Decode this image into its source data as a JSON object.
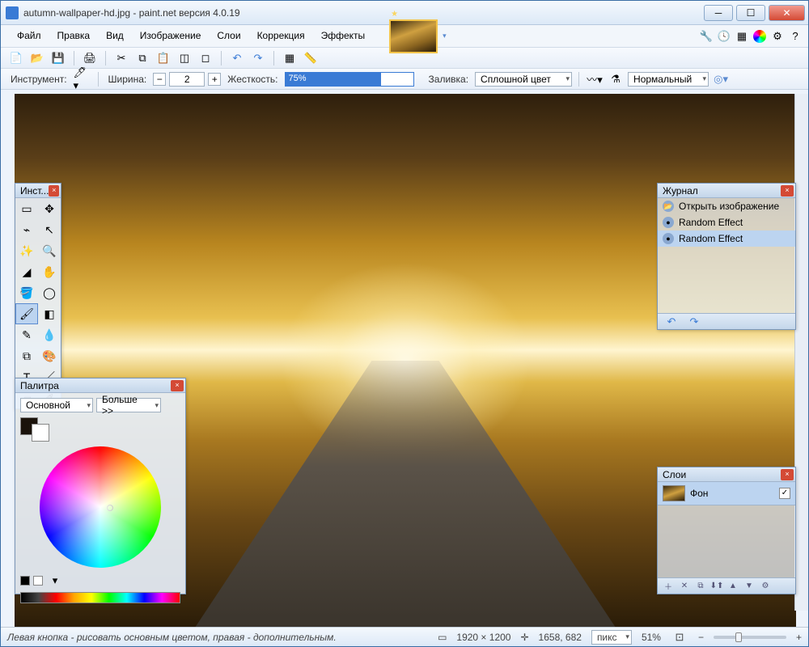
{
  "titlebar": {
    "title": "autumn-wallpaper-hd.jpg - paint.net версия 4.0.19"
  },
  "menu": {
    "items": [
      "Файл",
      "Правка",
      "Вид",
      "Изображение",
      "Слои",
      "Коррекция",
      "Эффекты"
    ]
  },
  "options": {
    "tool_label": "Инструмент:",
    "width_label": "Ширина:",
    "width_value": "2",
    "hardness_label": "Жесткость:",
    "hardness_value": "75%",
    "fill_label": "Заливка:",
    "fill_value": "Сплошной цвет",
    "blend_value": "Нормальный"
  },
  "tools_panel": {
    "title": "Инст..."
  },
  "palette_panel": {
    "title": "Палитра",
    "primary_label": "Основной",
    "more_label": "Больше >>"
  },
  "history_panel": {
    "title": "Журнал",
    "items": [
      {
        "icon": "📂",
        "label": "Открыть изображение"
      },
      {
        "icon": "●",
        "label": "Random Effect"
      },
      {
        "icon": "●",
        "label": "Random Effect"
      }
    ]
  },
  "layers_panel": {
    "title": "Слои",
    "layer_name": "Фон"
  },
  "statusbar": {
    "hint": "Левая кнопка - рисовать основным цветом, правая - дополнительным.",
    "size": "1920 × 1200",
    "cursor": "1658, 682",
    "units": "пикс",
    "zoom": "51%"
  }
}
